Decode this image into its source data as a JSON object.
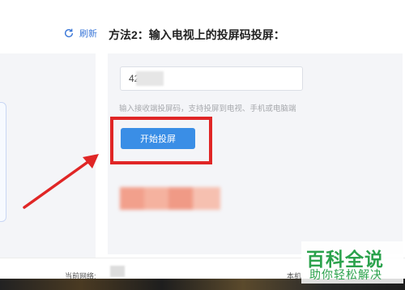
{
  "header": {
    "refresh_label": "刷新",
    "method_title": "方法2：输入电视上的投屏码投屏："
  },
  "form": {
    "code_value": "42",
    "hint": "输入接收端投屏码，支持投屏到电视、手机或电脑端",
    "start_button": "开始投屏"
  },
  "footer": {
    "network_label": "当前网络:",
    "right_label": "本机"
  },
  "watermark": {
    "title": "百科全说",
    "subtitle": "助你轻松解决"
  },
  "colors": {
    "primary": "#3a8ee6",
    "highlight": "#e02626",
    "watermark": "#2ba24c"
  }
}
